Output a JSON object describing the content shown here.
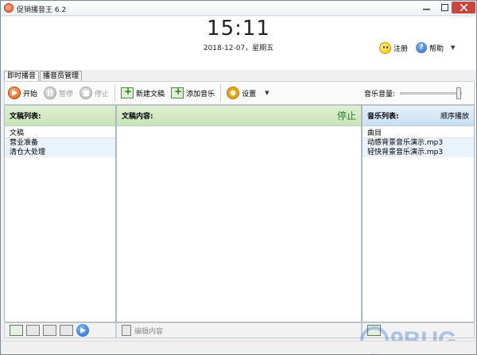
{
  "window": {
    "title": "促销播音王 6.2",
    "controls": {
      "minimize": "minimize-icon",
      "maximize": "maximize-icon",
      "close": "close-icon"
    }
  },
  "header": {
    "clock": "15:11",
    "date": "2018-12-07，星期五",
    "register_label": "注册",
    "help_label": "帮助"
  },
  "tabs": [
    {
      "label": "即时播音",
      "active": true
    },
    {
      "label": "播音员管理",
      "active": false
    }
  ],
  "toolbar": {
    "start_label": "开始",
    "pause_label": "暂停",
    "stop_label": "停止",
    "new_doc_label": "新建文稿",
    "add_music_label": "添加音乐",
    "settings_label": "设置",
    "volume_label": "音乐音量:",
    "volume_level": 1.0
  },
  "left_panel": {
    "title": "文稿列表:",
    "column_header": "文稿",
    "items": [
      "营业准备",
      "清仓大处理"
    ]
  },
  "middle_panel": {
    "title": "文稿内容:",
    "status": "停止",
    "edit_label": "编辑内容"
  },
  "right_panel": {
    "title": "音乐列表:",
    "mode": "顺序播放",
    "column_header": "曲目",
    "items": [
      "动感背景音乐演示.mp3",
      "轻快背景音乐演示.mp3"
    ]
  },
  "colors": {
    "accent_green_header": "#c8e4b7",
    "accent_blue_header": "#c9def3",
    "start_orange": "#e35a12",
    "close_red": "#c9463d"
  }
}
